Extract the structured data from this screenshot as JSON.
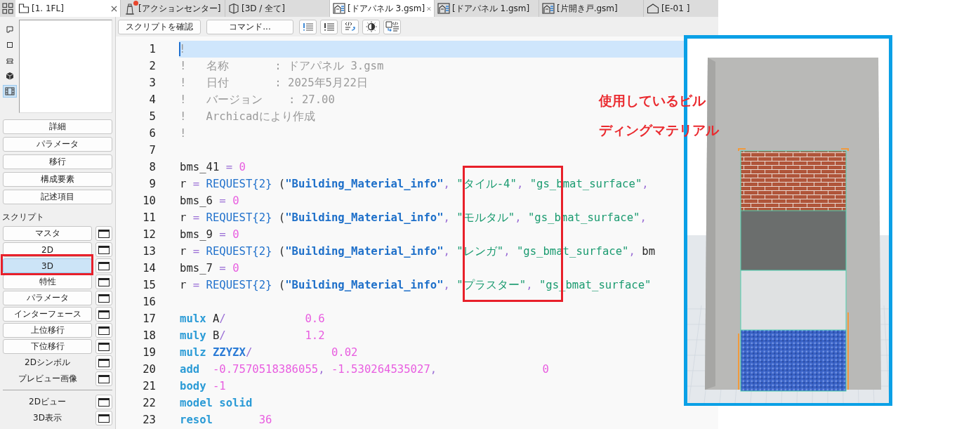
{
  "tabs": [
    {
      "kind": "floorplan",
      "label": "[1. 1FL]",
      "selected": true,
      "notification": false
    },
    {
      "kind": "tower",
      "label": "[アクションセンター]",
      "selected": false,
      "notification": true
    },
    {
      "kind": "box",
      "label": "[3D / 全て]",
      "selected": false,
      "notification": false
    },
    {
      "kind": "object",
      "label": "[ドアパネル 3.gsm]",
      "selected": true,
      "notification": false
    },
    {
      "kind": "object",
      "label": "[ドアパネル 1.gsm]",
      "selected": false,
      "notification": false
    },
    {
      "kind": "object",
      "label": "[片開き戸.gsm]",
      "selected": false,
      "notification": false
    },
    {
      "kind": "house",
      "label": "[E-01 ]",
      "selected": false,
      "notification": false
    }
  ],
  "view_tools": [
    {
      "kind": "frame",
      "selected": false
    },
    {
      "kind": "square",
      "selected": false
    },
    {
      "kind": "bench",
      "selected": false
    },
    {
      "kind": "cube",
      "selected": false
    },
    {
      "kind": "film",
      "selected": true
    }
  ],
  "sections": [
    "詳細",
    "パラメータ",
    "移行",
    "構成要素",
    "記述項目"
  ],
  "scripts_label": "スクリプト",
  "scripts": [
    {
      "label": "マスタ",
      "kind": "button",
      "selected": false
    },
    {
      "label": "2D",
      "kind": "button",
      "selected": false
    },
    {
      "label": "3D",
      "kind": "button",
      "selected": true
    },
    {
      "label": "特性",
      "kind": "button",
      "selected": false
    },
    {
      "label": "パラメータ",
      "kind": "button",
      "selected": false
    },
    {
      "label": "インターフェース",
      "kind": "button",
      "selected": false
    },
    {
      "label": "上位移行",
      "kind": "button",
      "selected": false
    },
    {
      "label": "下位移行",
      "kind": "button",
      "selected": false
    },
    {
      "label": "2Dシンボル",
      "kind": "plain",
      "selected": false
    },
    {
      "label": "プレビュー画像",
      "kind": "plain",
      "selected": false
    },
    {
      "label": "2Dビュー",
      "kind": "divided",
      "selected": false
    },
    {
      "label": "3D表示",
      "kind": "plain",
      "selected": false
    }
  ],
  "toolbar": {
    "buttons": [
      "スクリプトを確認",
      "コマンド..."
    ]
  },
  "code": [
    {
      "no": "1",
      "current": true,
      "tokens": [
        {
          "kind": "comment",
          "t": "!"
        }
      ]
    },
    {
      "no": "2",
      "current": false,
      "tokens": [
        {
          "kind": "comment",
          "t": "!   名称       : ドアパネル 3.gsm"
        }
      ]
    },
    {
      "no": "3",
      "current": false,
      "tokens": [
        {
          "kind": "comment",
          "t": "!   日付       : 2025年5月22日"
        }
      ]
    },
    {
      "no": "4",
      "current": false,
      "tokens": [
        {
          "kind": "comment",
          "t": "!   バージョン    : 27.00"
        }
      ]
    },
    {
      "no": "5",
      "current": false,
      "tokens": [
        {
          "kind": "comment",
          "t": "!   Archicadにより作成"
        }
      ]
    },
    {
      "no": "6",
      "current": false,
      "tokens": [
        {
          "kind": "comment",
          "t": "!"
        }
      ]
    },
    {
      "no": "7",
      "current": false
    },
    {
      "no": "8",
      "current": false,
      "tokens": [
        {
          "kind": "plain",
          "t": "bms_41 "
        },
        {
          "kind": "op",
          "t": "= "
        },
        {
          "kind": "num",
          "t": "0"
        }
      ]
    },
    {
      "no": "9",
      "current": false,
      "tokens": [
        {
          "kind": "plain",
          "t": "r "
        },
        {
          "kind": "op",
          "t": "= "
        },
        {
          "kind": "func",
          "t": "REQUEST{2} "
        },
        {
          "kind": "plain",
          "t": "("
        },
        {
          "kind": "bstr",
          "t": "\"Building_Material_info\""
        },
        {
          "kind": "op",
          "t": ", "
        },
        {
          "kind": "str",
          "t": "\"タイル-4\""
        },
        {
          "kind": "op",
          "t": ", "
        },
        {
          "kind": "str",
          "t": "\"gs_bmat_surface\""
        },
        {
          "kind": "op",
          "t": ","
        }
      ]
    },
    {
      "no": "10",
      "current": false,
      "tokens": [
        {
          "kind": "plain",
          "t": "bms_6 "
        },
        {
          "kind": "op",
          "t": "= "
        },
        {
          "kind": "num",
          "t": "0"
        }
      ]
    },
    {
      "no": "11",
      "current": false,
      "tokens": [
        {
          "kind": "plain",
          "t": "r "
        },
        {
          "kind": "op",
          "t": "= "
        },
        {
          "kind": "func",
          "t": "REQUEST{2} "
        },
        {
          "kind": "plain",
          "t": "("
        },
        {
          "kind": "bstr",
          "t": "\"Building_Material_info\""
        },
        {
          "kind": "op",
          "t": ", "
        },
        {
          "kind": "str",
          "t": "\"モルタル\""
        },
        {
          "kind": "op",
          "t": ", "
        },
        {
          "kind": "str",
          "t": "\"gs_bmat_surface\""
        },
        {
          "kind": "op",
          "t": ","
        }
      ]
    },
    {
      "no": "12",
      "current": false,
      "tokens": [
        {
          "kind": "plain",
          "t": "bms_9 "
        },
        {
          "kind": "op",
          "t": "= "
        },
        {
          "kind": "num",
          "t": "0"
        }
      ]
    },
    {
      "no": "13",
      "current": false,
      "tokens": [
        {
          "kind": "plain",
          "t": "r "
        },
        {
          "kind": "op",
          "t": "= "
        },
        {
          "kind": "func",
          "t": "REQUEST{2} "
        },
        {
          "kind": "plain",
          "t": "("
        },
        {
          "kind": "bstr",
          "t": "\"Building_Material_info\""
        },
        {
          "kind": "op",
          "t": ", "
        },
        {
          "kind": "str",
          "t": "\"レンガ\""
        },
        {
          "kind": "op",
          "t": ", "
        },
        {
          "kind": "str",
          "t": "\"gs_bmat_surface\""
        },
        {
          "kind": "op",
          "t": ", "
        },
        {
          "kind": "plain",
          "t": "bm"
        }
      ]
    },
    {
      "no": "14",
      "current": false,
      "tokens": [
        {
          "kind": "plain",
          "t": "bms_7 "
        },
        {
          "kind": "op",
          "t": "= "
        },
        {
          "kind": "num",
          "t": "0"
        }
      ]
    },
    {
      "no": "15",
      "current": false,
      "tokens": [
        {
          "kind": "plain",
          "t": "r "
        },
        {
          "kind": "op",
          "t": "= "
        },
        {
          "kind": "func",
          "t": "REQUEST{2} "
        },
        {
          "kind": "plain",
          "t": "("
        },
        {
          "kind": "bstr",
          "t": "\"Building_Material_info\""
        },
        {
          "kind": "op",
          "t": ", "
        },
        {
          "kind": "str",
          "t": "\"プラスター\""
        },
        {
          "kind": "op",
          "t": ", "
        },
        {
          "kind": "str",
          "t": "\"gs_bmat_surface\""
        }
      ]
    },
    {
      "no": "16",
      "current": false
    },
    {
      "no": "17",
      "current": false,
      "tokens": [
        {
          "kind": "kw",
          "t": "mulx"
        },
        {
          "kind": "plain",
          "t": " A"
        },
        {
          "kind": "op",
          "t": "/"
        },
        {
          "kind": "num",
          "t": "            0.6"
        }
      ]
    },
    {
      "no": "18",
      "current": false,
      "tokens": [
        {
          "kind": "kw",
          "t": "muly"
        },
        {
          "kind": "plain",
          "t": " B"
        },
        {
          "kind": "op",
          "t": "/"
        },
        {
          "kind": "num",
          "t": "            1.2"
        }
      ]
    },
    {
      "no": "19",
      "current": false,
      "tokens": [
        {
          "kind": "kw",
          "t": "mulz"
        },
        {
          "kind": "ident",
          "t": " ZZYZX"
        },
        {
          "kind": "op",
          "t": "/"
        },
        {
          "kind": "num",
          "t": "            0.02"
        }
      ]
    },
    {
      "no": "20",
      "current": false,
      "tokens": [
        {
          "kind": "kw",
          "t": "add"
        },
        {
          "kind": "num",
          "t": "  -0.7570518386055"
        },
        {
          "kind": "op",
          "t": ", "
        },
        {
          "kind": "num",
          "t": "-1.530264535027"
        },
        {
          "kind": "op",
          "t": ","
        },
        {
          "kind": "num",
          "t": "                0"
        }
      ]
    },
    {
      "no": "21",
      "current": false,
      "tokens": [
        {
          "kind": "kw",
          "t": "body"
        },
        {
          "kind": "num",
          "t": " -1"
        }
      ]
    },
    {
      "no": "22",
      "current": false,
      "tokens": [
        {
          "kind": "kw",
          "t": "model solid"
        }
      ]
    },
    {
      "no": "23",
      "current": false,
      "tokens": [
        {
          "kind": "kw",
          "t": "resol"
        },
        {
          "kind": "num",
          "t": "       36"
        }
      ]
    }
  ],
  "annotation": {
    "lines": [
      "使用しているビル",
      "ディングマテリアル"
    ]
  }
}
